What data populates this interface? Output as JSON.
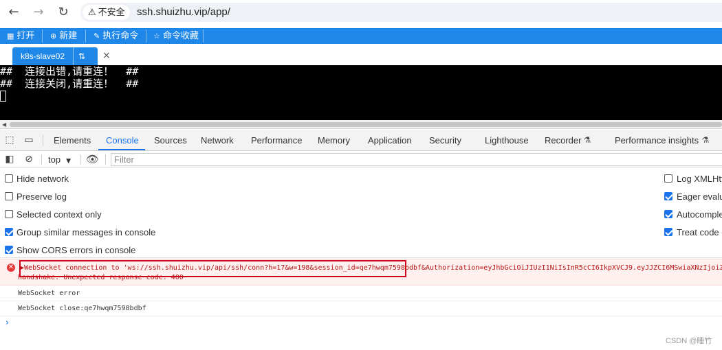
{
  "browser": {
    "back_icon": "arrow-left-icon",
    "forward_icon": "arrow-right-icon",
    "reload_icon": "reload-icon",
    "security_label": "不安全",
    "url": "ssh.shuizhu.vip/app/"
  },
  "app_toolbar": {
    "open": "打开",
    "new": "新建",
    "execute": "执行命令",
    "favorites": "命令收藏"
  },
  "terminal_tab": {
    "label": "k8s-slave02",
    "close": "×"
  },
  "terminal": {
    "lines": [
      "##  连接出错,请重连！  ##",
      "##  连接关闭,请重连！  ##"
    ]
  },
  "devtools": {
    "tabs": [
      "Elements",
      "Console",
      "Sources",
      "Network",
      "Performance",
      "Memory",
      "Application",
      "Security",
      "Lighthouse",
      "Recorder",
      "Performance insights"
    ],
    "active_tab": "Console",
    "accent_color": "#1a73e8"
  },
  "console_toolbar": {
    "context": "top",
    "filter_placeholder": "Filter"
  },
  "settings": {
    "left": [
      {
        "label": "Hide network",
        "checked": false
      },
      {
        "label": "Preserve log",
        "checked": false
      },
      {
        "label": "Selected context only",
        "checked": false
      },
      {
        "label": "Group similar messages in console",
        "checked": true
      },
      {
        "label": "Show CORS errors in console",
        "checked": true
      }
    ],
    "right": [
      {
        "label": "Log XMLHtt",
        "checked": false
      },
      {
        "label": "Eager evalu",
        "checked": true
      },
      {
        "label": "Autocomple",
        "checked": true
      },
      {
        "label": "Treat code e",
        "checked": true
      }
    ]
  },
  "messages": {
    "error_line1": "WebSocket connection to 'ws://ssh.shuizhu.vip/api/ssh/conn?h=17&w=198&session_id=qe7hwqm7598bdbf&Authorization=eyJhbGciOiJIUzI1NiIsInR5cCI6IkpXVCJ9.eyJJZCI6MSwiaXNzIjoiZ",
    "error_line2": "handshake: Unexpected response code: 400",
    "log1": "WebSocket error",
    "log2": "WebSocket close:qe7hwqm7598bdbf",
    "error_color": "#b31412"
  },
  "watermark": "CSDN @睡竹"
}
